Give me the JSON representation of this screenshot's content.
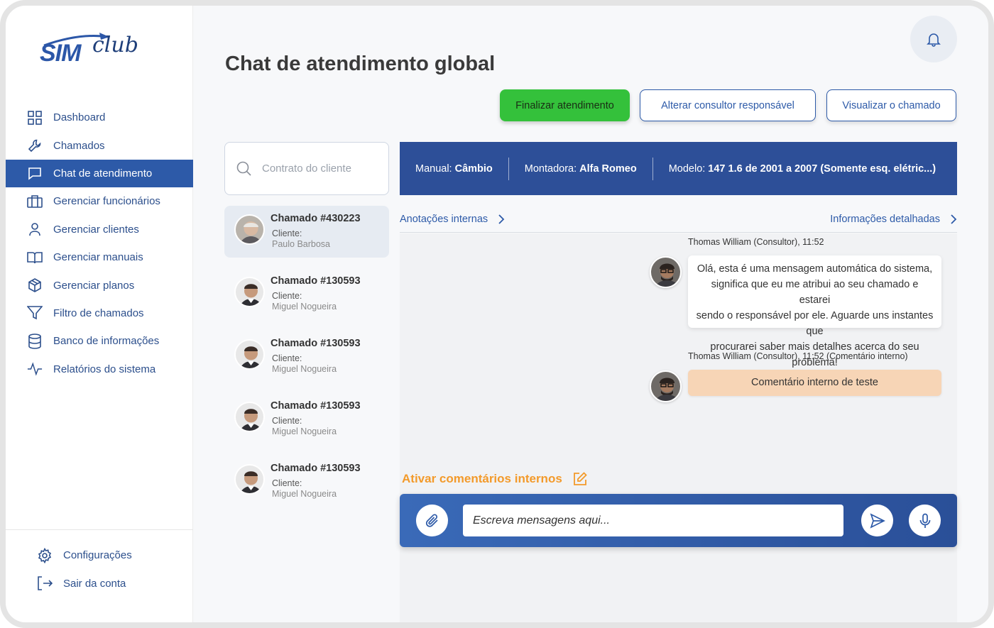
{
  "brand": {
    "logo_text_a": "SIM",
    "logo_text_b": "club"
  },
  "sidebar": {
    "items": [
      {
        "label": "Dashboard",
        "icon": "grid-icon"
      },
      {
        "label": "Chamados",
        "icon": "wrench-icon"
      },
      {
        "label": "Chat de atendimento",
        "icon": "chat-icon",
        "active": true
      },
      {
        "label": "Gerenciar funcionários",
        "icon": "briefcase-icon"
      },
      {
        "label": "Gerenciar clientes",
        "icon": "user-icon"
      },
      {
        "label": "Gerenciar manuais",
        "icon": "book-icon"
      },
      {
        "label": "Gerenciar planos",
        "icon": "box-icon"
      },
      {
        "label": "Filtro de chamados",
        "icon": "filter-icon"
      },
      {
        "label": "Banco de informações",
        "icon": "database-icon"
      },
      {
        "label": "Relatórios do sistema",
        "icon": "activity-icon"
      }
    ],
    "bottom": [
      {
        "label": "Configurações",
        "icon": "gear-icon"
      },
      {
        "label": "Sair da conta",
        "icon": "logout-icon"
      }
    ]
  },
  "header": {
    "title": "Chat de atendimento global",
    "buttons": {
      "finish": "Finalizar atendimento",
      "change_consultant": "Alterar consultor responsável",
      "view_ticket": "Visualizar o chamado"
    }
  },
  "search": {
    "placeholder": "Contrato do cliente"
  },
  "tickets": [
    {
      "name": "Chamado #430223",
      "label": "Cliente:",
      "client": "Paulo Barbosa",
      "selected": true
    },
    {
      "name": "Chamado #130593",
      "label": "Cliente:",
      "client": "Miguel Nogueira"
    },
    {
      "name": "Chamado #130593",
      "label": "Cliente:",
      "client": "Miguel Nogueira"
    },
    {
      "name": "Chamado #130593",
      "label": "Cliente:",
      "client": "Miguel Nogueira"
    },
    {
      "name": "Chamado #130593",
      "label": "Cliente:",
      "client": "Miguel Nogueira"
    }
  ],
  "infobar": {
    "manual_label": "Manual:",
    "manual_value": "Câmbio",
    "maker_label": "Montadora:",
    "maker_value": "Alfa Romeo",
    "model_label": "Modelo:",
    "model_value": "147 1.6 de 2001 a 2007 (Somente esq. elétric...)"
  },
  "links": {
    "notes": "Anotações internas",
    "details": "Informações detalhadas"
  },
  "messages": [
    {
      "meta": "Thomas William (Consultor), 11:52",
      "text_lines": [
        "Olá, esta é uma mensagem automática do sistema,",
        "significa que eu me atribui ao seu chamado e estarei",
        "sendo o responsável por ele. Aguarde uns instantes que",
        "procurarei saber mais detalhes acerca do seu problema!"
      ]
    },
    {
      "meta": "Thomas William (Consultor), 11:52 (Comentário interno)",
      "text": "Comentário interno de teste",
      "internal": true
    }
  ],
  "composer": {
    "toggle_label": "Ativar comentários internos",
    "placeholder": "Escreva mensagens aqui..."
  },
  "colors": {
    "primary": "#2d5aa8",
    "success": "#34c13b",
    "accent_orange": "#f39a2a",
    "internal_bubble": "#f7d5b6"
  }
}
